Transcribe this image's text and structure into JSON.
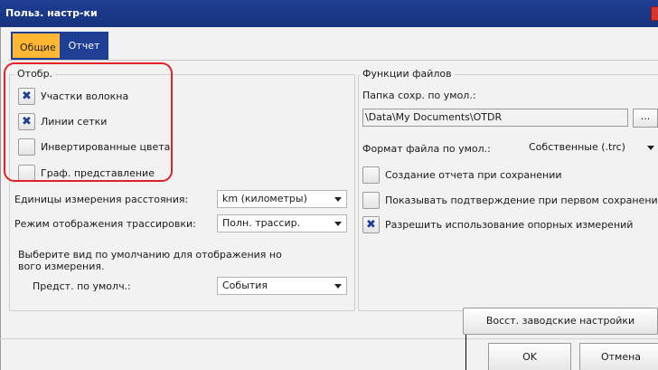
{
  "window": {
    "title": "Польз. настр-ки"
  },
  "tabs": [
    {
      "label": "Общие",
      "active": true
    },
    {
      "label": "Отчет",
      "active": false
    }
  ],
  "display_group": {
    "legend": "Отобр.",
    "checkboxes": [
      {
        "label": "Участки волокна",
        "checked": true
      },
      {
        "label": "Линии сетки",
        "checked": true
      },
      {
        "label": "Инвертированные цвета",
        "checked": false
      },
      {
        "label": "Граф. представление",
        "checked": false
      }
    ],
    "distance_units": {
      "label": "Единицы измерения расстояния:",
      "value": "km (километры)"
    },
    "trace_mode": {
      "label": "Режим отображения трассировки:",
      "value": "Полн. трассир."
    },
    "default_view_hint": [
      "Выберите вид по умолчанию для отображения но",
      "вого измерения."
    ],
    "default_view": {
      "label": "Предст. по умолч.:",
      "value": "События"
    }
  },
  "file_group": {
    "legend": "Функции файлов",
    "folder_label": "Папка сохр. по умол.:",
    "folder_path": "\\Data\\My Documents\\OTDR",
    "browse_label": "...",
    "format": {
      "label": "Формат файла по умол.:",
      "value": "Собственные (.trc)"
    },
    "checkboxes": [
      {
        "label": "Создание отчета при сохранении",
        "checked": false
      },
      {
        "label": "Показывать подтверждение при первом сохранении",
        "checked": false
      },
      {
        "label": "Разрешить использование опорных измерений",
        "checked": true
      }
    ]
  },
  "buttons": {
    "restore": "Восст. заводские настройки",
    "ok": "OK",
    "cancel": "Отмена"
  },
  "colors": {
    "accent": "#1f3f94",
    "active_tab": "#ffb833",
    "highlight": "#e0202a"
  }
}
